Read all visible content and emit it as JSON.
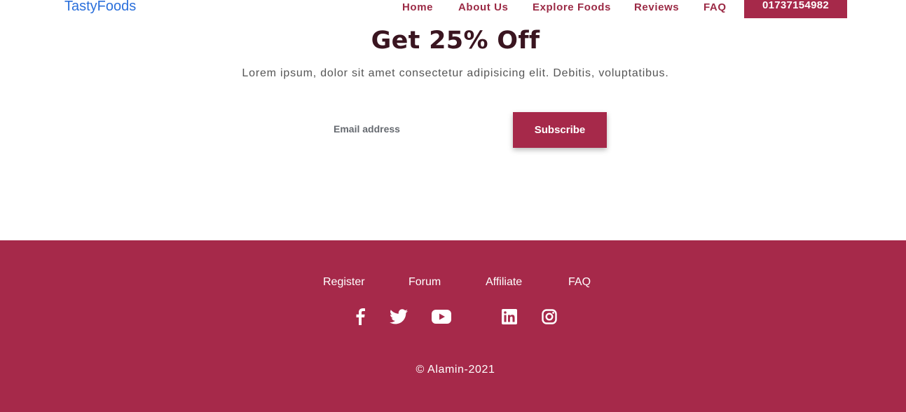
{
  "header": {
    "brand": "TastyFoods",
    "nav": [
      "Home",
      "About Us",
      "Explore Foods",
      "Reviews",
      "FAQ"
    ],
    "phone": "01737154982"
  },
  "promo": {
    "title": "Get 25% Off",
    "subtitle": "Lorem ipsum, dolor sit amet consectetur adipisicing elit. Debitis, voluptatibus.",
    "email_placeholder": "Email address",
    "subscribe_label": "Subscribe"
  },
  "footer": {
    "links": [
      "Register",
      "Forum",
      "Affiliate",
      "FAQ"
    ],
    "social": [
      "facebook-icon",
      "twitter-icon",
      "youtube-icon",
      "linkedin-icon",
      "instagram-icon"
    ],
    "copyright": "© Alamin-2021"
  },
  "colors": {
    "accent": "#a6294a",
    "nav_text": "#9b2a45",
    "brand_text": "#2a6fdb",
    "heading": "#3a1520"
  }
}
